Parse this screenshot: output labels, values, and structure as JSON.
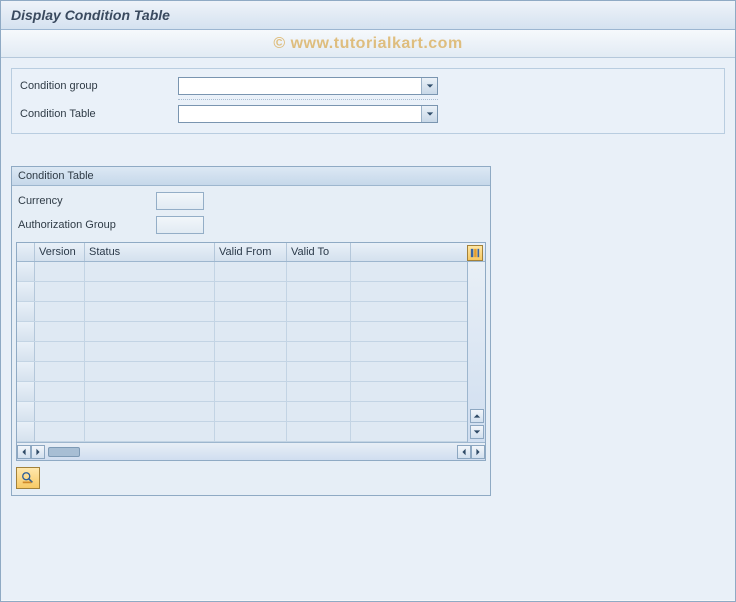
{
  "title": "Display Condition Table",
  "watermark": "© www.tutorialkart.com",
  "selection": {
    "condition_group_label": "Condition group",
    "condition_group_value": "",
    "condition_table_label": "Condition Table",
    "condition_table_value": ""
  },
  "panel": {
    "title": "Condition Table",
    "currency_label": "Currency",
    "currency_value": "",
    "auth_group_label": "Authorization Group",
    "auth_group_value": ""
  },
  "grid": {
    "columns": {
      "version": "Version",
      "status": "Status",
      "valid_from": "Valid From",
      "valid_to": "Valid To"
    },
    "rows": [
      {
        "version": "",
        "status": "",
        "valid_from": "",
        "valid_to": ""
      },
      {
        "version": "",
        "status": "",
        "valid_from": "",
        "valid_to": ""
      },
      {
        "version": "",
        "status": "",
        "valid_from": "",
        "valid_to": ""
      },
      {
        "version": "",
        "status": "",
        "valid_from": "",
        "valid_to": ""
      },
      {
        "version": "",
        "status": "",
        "valid_from": "",
        "valid_to": ""
      },
      {
        "version": "",
        "status": "",
        "valid_from": "",
        "valid_to": ""
      },
      {
        "version": "",
        "status": "",
        "valid_from": "",
        "valid_to": ""
      },
      {
        "version": "",
        "status": "",
        "valid_from": "",
        "valid_to": ""
      },
      {
        "version": "",
        "status": "",
        "valid_from": "",
        "valid_to": ""
      }
    ]
  }
}
